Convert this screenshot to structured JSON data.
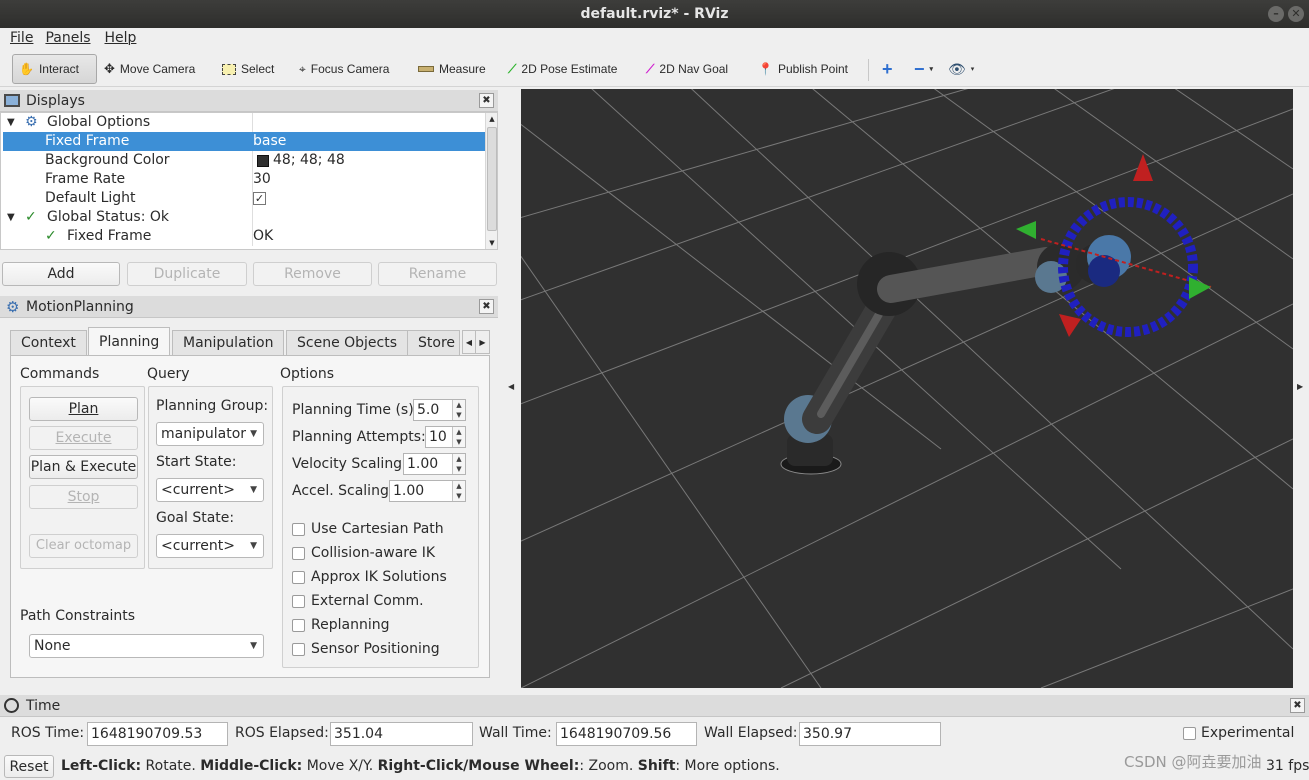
{
  "window": {
    "title": "default.rviz* - RViz"
  },
  "menu": [
    "File",
    "Panels",
    "Help"
  ],
  "toolbar": {
    "interact": "Interact",
    "move_camera": "Move Camera",
    "select": "Select",
    "focus_camera": "Focus Camera",
    "measure": "Measure",
    "pose_estimate": "2D Pose Estimate",
    "nav_goal": "2D Nav Goal",
    "publish_point": "Publish Point"
  },
  "displays": {
    "title": "Displays",
    "rows": [
      {
        "label": "Global Options",
        "value": ""
      },
      {
        "label": "Fixed Frame",
        "value": "base"
      },
      {
        "label": "Background Color",
        "value": "48; 48; 48"
      },
      {
        "label": "Frame Rate",
        "value": "30"
      },
      {
        "label": "Default Light",
        "value": "✓"
      },
      {
        "label": "Global Status: Ok",
        "value": ""
      },
      {
        "label": "Fixed Frame",
        "value": "OK"
      }
    ],
    "buttons": {
      "add": "Add",
      "duplicate": "Duplicate",
      "remove": "Remove",
      "rename": "Rename"
    }
  },
  "motion": {
    "title": "MotionPlanning",
    "tabs": [
      "Context",
      "Planning",
      "Manipulation",
      "Scene Objects",
      "Store"
    ],
    "commands": {
      "title": "Commands",
      "plan": "Plan",
      "execute": "Execute",
      "plan_execute": "Plan & Execute",
      "stop": "Stop",
      "clear_octomap": "Clear octomap"
    },
    "query": {
      "title": "Query",
      "planning_group_label": "Planning Group:",
      "planning_group": "manipulator",
      "start_state_label": "Start State:",
      "start_state": "<current>",
      "goal_state_label": "Goal State:",
      "goal_state": "<current>"
    },
    "options": {
      "title": "Options",
      "planning_time_label": "Planning Time (s):",
      "planning_time": "5.0",
      "planning_attempts_label": "Planning Attempts:",
      "planning_attempts": "10",
      "velocity_label": "Velocity Scaling:",
      "velocity": "1.00",
      "accel_label": "Accel. Scaling:",
      "accel": "1.00",
      "checks": [
        "Use Cartesian Path",
        "Collision-aware IK",
        "Approx IK Solutions",
        "External Comm.",
        "Replanning",
        "Sensor Positioning"
      ]
    },
    "path_constraints": {
      "label": "Path Constraints",
      "value": "None"
    }
  },
  "time": {
    "title": "Time",
    "ros_time_label": "ROS Time:",
    "ros_time": "1648190709.53",
    "ros_elapsed_label": "ROS Elapsed:",
    "ros_elapsed": "351.04",
    "wall_time_label": "Wall Time:",
    "wall_time": "1648190709.56",
    "wall_elapsed_label": "Wall Elapsed:",
    "wall_elapsed": "350.97",
    "experimental": "Experimental"
  },
  "status": {
    "reset": "Reset",
    "left": "Left-Click:",
    "left_desc": " Rotate. ",
    "middle": "Middle-Click:",
    "middle_desc": " Move X/Y. ",
    "right": "Right-Click/Mouse Wheel:",
    "right_desc": ": Zoom. ",
    "shift": "Shift",
    "shift_desc": ": More options.",
    "fps": "31 fps",
    "watermark": "CSDN @阿垚要加油"
  }
}
